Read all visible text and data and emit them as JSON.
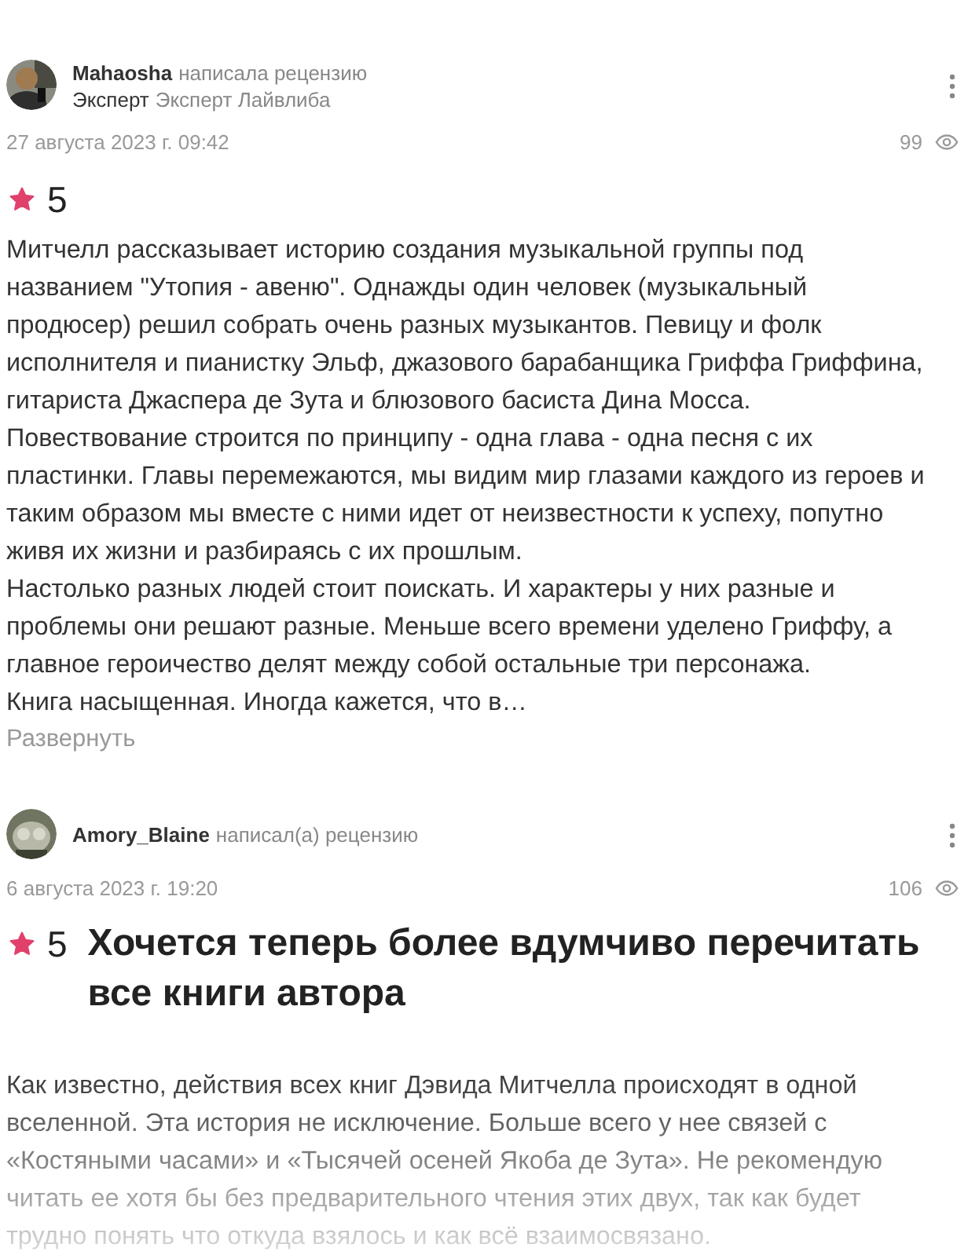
{
  "reviews": [
    {
      "author": "Mahaosha",
      "action": "написала рецензию",
      "badge": "Эксперт",
      "badge_note": "Эксперт Лайвлиба",
      "date": "27 августа 2023 г. 09:42",
      "views": "99",
      "rating": "5",
      "paragraphs": [
        "Митчелл рассказывает историю создания музыкальной группы под названием \"Утопия - авеню\". Однажды один человек (музыкальный продюсер) решил собрать очень разных музыкантов. Певицу и фолк исполнителя и пианистку Эльф, джазового барабанщика Гриффа Гриффина, гитариста Джаспера де Зута и блюзового басиста Дина Мосса. Повествование строится по принципу - одна глава - одна песня с их пластинки. Главы перемежаются, мы видим мир глазами каждого из героев и таким образом мы вместе с ними идет от неизвестности к успеху, попутно живя их жизни и разбираясь с их прошлым.",
        "Настолько разных людей стоит поискать. И характеры у них разные и проблемы они решают разные. Меньше всего времени уделено Гриффу, а главное героичество делят между собой остальные три персонажа.",
        "Книга насыщенная. Иногда кажется, что в…"
      ],
      "expand": "Развернуть",
      "faded": false
    },
    {
      "author": "Amory_Blaine",
      "action": "написал(а) рецензию",
      "date": "6 августа 2023 г. 19:20",
      "views": "106",
      "rating": "5",
      "title": "Хочется теперь более вдумчиво перечитать все книги автора",
      "paragraphs": [
        "Как известно, действия всех книг Дэвида Митчелла происходят в одной вселенной. Эта история не исключение. Больше всего у нее связей с «Костяными часами» и «Тысячей осеней Якоба де Зута». Не рекомендую читать ее хотя бы без предварительного чтения этих двух, так как будет трудно понять что откуда взялось  и как всё взаимосвязано."
      ],
      "faded": true
    }
  ]
}
